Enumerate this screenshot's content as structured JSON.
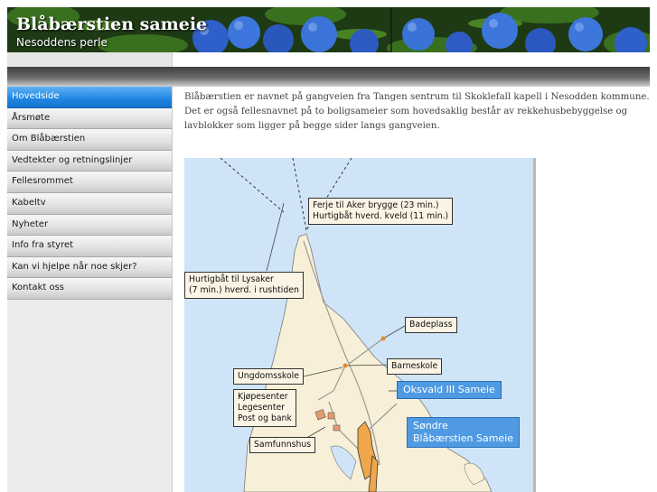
{
  "header": {
    "title": "Blåbærstien sameie",
    "subtitle": "Nesoddens perle"
  },
  "sidebar": {
    "items": [
      {
        "label": "Hovedside",
        "active": true
      },
      {
        "label": "Årsmøte"
      },
      {
        "label": "Om Blåbærstien"
      },
      {
        "label": "Vedtekter og retningslinjer"
      },
      {
        "label": "Fellesrommet"
      },
      {
        "label": "Kabeltv"
      },
      {
        "label": "Nyheter"
      },
      {
        "label": "Info fra styret"
      },
      {
        "label": "Kan vi hjelpe når noe skjer?"
      },
      {
        "label": "Kontakt oss"
      }
    ]
  },
  "main": {
    "intro": "Blåbærstien er navnet på gangveien fra Tangen sentrum til Skoklefall kapell i Nesodden kommune. Det er også fellesnavnet på to boligsameier som hovedsaklig består av rekkehusbebyggelse og lavblokker som ligger på begge sider langs gangveien."
  },
  "map": {
    "ferry_line1": "Ferje til Aker brygge (23 min.)",
    "ferry_line2": "Hurtigbåt hverd. kveld (11 min.)",
    "lysaker_line1": "Hurtigbåt til Lysaker",
    "lysaker_line2": "(7 min.) hverd. i rushtiden",
    "badeplass": "Badeplass",
    "barneskole": "Barneskole",
    "ungdomsskole": "Ungdomsskole",
    "kjopesenter_line1": "Kjøpesenter",
    "kjopesenter_line2": "Legesenter",
    "kjopesenter_line3": "Post og bank",
    "samfunnshus": "Samfunnshus",
    "oksvald": "Oksvald III Sameie",
    "sondre_line1": "Søndre",
    "sondre_line2": "Blåbærstien Sameie"
  },
  "colors": {
    "nav_active": "#1f86e2",
    "water": "#cfe4f7",
    "land": "#f7efd7",
    "sameie_label": "#4f9ae2",
    "sameie_area": "#f0a64a"
  }
}
